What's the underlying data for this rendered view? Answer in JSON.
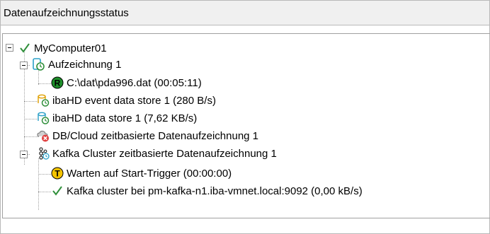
{
  "header": {
    "title": "Datenaufzeichnungsstatus"
  },
  "tree": {
    "root": {
      "label": "MyComputer01"
    },
    "items": [
      {
        "label": "Aufzeichnung 1"
      },
      {
        "label": "C:\\dat\\pda996.dat (00:05:11)"
      },
      {
        "label": "ibaHD event data store 1 (280 B/s)"
      },
      {
        "label": "ibaHD data store 1 (7,62 KB/s)"
      },
      {
        "label": "DB/Cloud zeitbasierte Datenaufzeichnung 1"
      },
      {
        "label": "Kafka Cluster zeitbasierte Datenaufzeichnung 1"
      },
      {
        "label": "Warten auf Start-Trigger (00:00:00)"
      },
      {
        "label": "Kafka cluster bei pm-kafka-n1.iba-vmnet.local:9092 (0,00 kB/s)"
      }
    ]
  },
  "colors": {
    "check": "#2f8f3a",
    "record": "#1e8f2a",
    "trigger": "#f5c400",
    "hd": "#2aa0c8"
  },
  "icons": [
    "check-icon",
    "recording-icon",
    "record-badge-icon",
    "hd-event-store-icon",
    "hd-store-icon",
    "db-cloud-error-icon",
    "kafka-cluster-icon",
    "trigger-badge-icon",
    "check-icon"
  ]
}
